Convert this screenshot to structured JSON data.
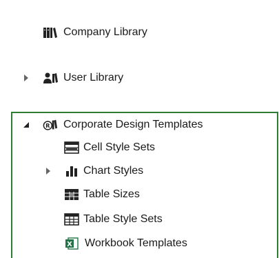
{
  "tree": {
    "company_library": {
      "label": "Company Library",
      "icon": "books-icon"
    },
    "user_library": {
      "label": "User Library",
      "icon": "users-icon",
      "expanded": false
    },
    "corporate": {
      "label": "Corporate Design Templates",
      "icon": "corporate-design-icon",
      "expanded": true,
      "children": [
        {
          "label": "Cell Style Sets",
          "icon": "cell-style-icon"
        },
        {
          "label": "Chart Styles",
          "icon": "bar-chart-icon",
          "expanded": false
        },
        {
          "label": "Table Sizes",
          "icon": "table-sizes-icon"
        },
        {
          "label": "Table Style Sets",
          "icon": "table-style-icon"
        },
        {
          "label": "Workbook Templates",
          "icon": "excel-workbook-icon"
        }
      ]
    }
  },
  "colors": {
    "selection_border": "#2e7d32",
    "excel_green": "#217346"
  }
}
